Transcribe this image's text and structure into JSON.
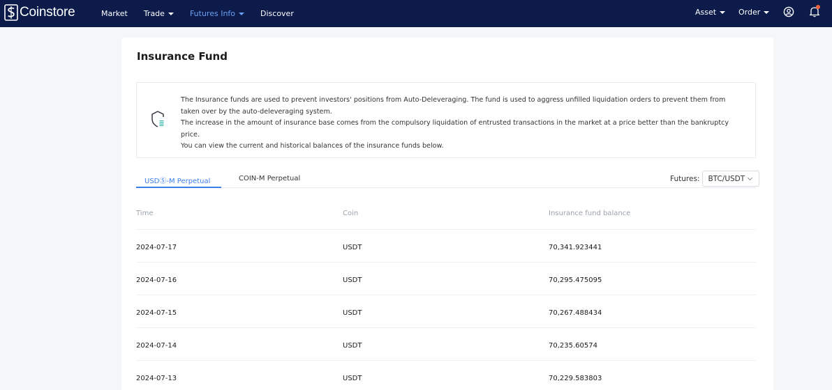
{
  "nav": {
    "brand": "Coinstore",
    "items": [
      {
        "label": "Market",
        "has_caret": false
      },
      {
        "label": "Trade",
        "has_caret": true
      },
      {
        "label": "Futures Info",
        "has_caret": true,
        "active": true
      },
      {
        "label": "Discover",
        "has_caret": false
      }
    ],
    "asset_label": "Asset",
    "order_label": "Order",
    "user_icon": "user-circle-icon",
    "bell_icon": "bell-icon"
  },
  "page": {
    "title": "Insurance Fund",
    "notice_icon": "shield-icon",
    "notice_lines": [
      "The Insurance funds are used to prevent investors' positions from Auto-Deleveraging. The fund is used to aggress unfilled liquidation orders to prevent them from taken over by the auto-deleveraging system.",
      "The increase in the amount of insurance base comes from the compulsory liquidation of entrusted transactions in the market at a price better than the bankruptcy price.",
      "You can view the current and historical balances of the insurance funds below."
    ]
  },
  "tabs": [
    {
      "label": "USDⓈ-M Perpetual",
      "active": true
    },
    {
      "label": "COIN-M Perpetual",
      "active": false
    }
  ],
  "futures": {
    "label": "Futures:",
    "selected": "BTC/USDT"
  },
  "table": {
    "headers": [
      "Time",
      "Coin",
      "Insurance fund balance"
    ],
    "rows": [
      [
        "2024-07-17",
        "USDT",
        "70,341.923441"
      ],
      [
        "2024-07-16",
        "USDT",
        "70,295.475095"
      ],
      [
        "2024-07-15",
        "USDT",
        "70,267.488434"
      ],
      [
        "2024-07-14",
        "USDT",
        "70,235.60574"
      ],
      [
        "2024-07-13",
        "USDT",
        "70,229.583803"
      ]
    ]
  },
  "colors": {
    "nav_bg": "#0c1b4a",
    "accent": "#3b7ee9",
    "active_nav": "#6aa2f7",
    "notification": "#f0633a"
  }
}
